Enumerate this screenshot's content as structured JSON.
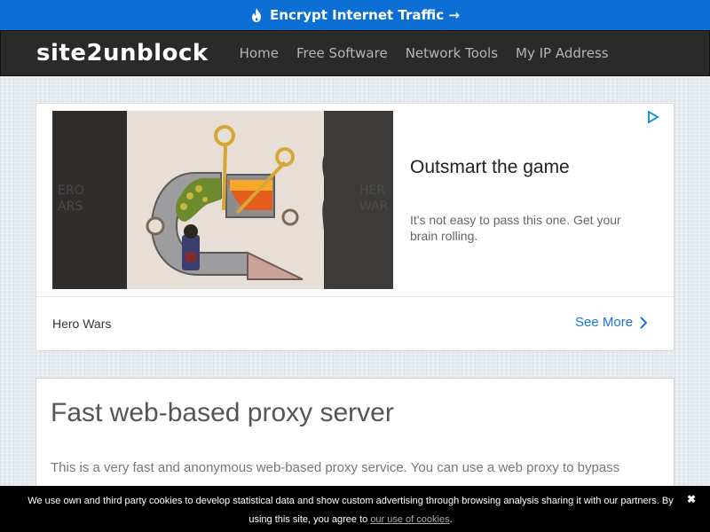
{
  "promo": {
    "text": "Encrypt Internet Traffic →",
    "icon": "flame-icon"
  },
  "navbar": {
    "brand": "site2unblock",
    "links": [
      "Home",
      "Free Software",
      "Network Tools",
      "My IP Address"
    ]
  },
  "ad": {
    "headline": "Outsmart the game",
    "description": "It's not easy to pass this one. Get your brain rolling.",
    "advertiser": "Hero Wars",
    "cta": "See More",
    "icon": "ad-choices-play-icon"
  },
  "content": {
    "title": "Fast web-based proxy server",
    "body": "This is a very fast and anonymous web-based proxy service. You can use a web proxy to bypass"
  },
  "cookie": {
    "text_before": "We use own and third party cookies to develop statistical data and show custom advertising through browsing analysis sharing it with our partners. By using this site, you agree to ",
    "link": "our use of cookies",
    "text_after": ".",
    "close": "✖"
  },
  "colors": {
    "promo_bg": "#0d6fd3",
    "navbar_bg": "#2a2a2a",
    "cta": "#1a73e8",
    "cookie_bg": "#000000"
  }
}
